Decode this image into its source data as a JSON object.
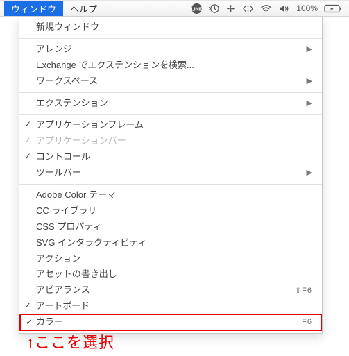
{
  "menubar": {
    "window": "ウィンドウ",
    "help": "ヘルプ",
    "battery": "100%"
  },
  "dropdown": {
    "new_window": "新規ウィンドウ",
    "arrange": "アレンジ",
    "find_ext": "Exchange でエクステンションを検索...",
    "workspace": "ワークスペース",
    "extension": "エクステンション",
    "app_frame": "アプリケーションフレーム",
    "app_bar": "アプリケーションバー",
    "control": "コントロール",
    "toolbar": "ツールバー",
    "adobe_color": "Adobe Color テーマ",
    "cc_library": "CC ライブラリ",
    "css_prop": "CSS プロパティ",
    "svg_inter": "SVG インタラクティビティ",
    "action": "アクション",
    "asset_export": "アセットの書き出し",
    "appearance": "アピアランス",
    "appearance_sc": "⇧F6",
    "artboard": "アートボード",
    "color": "カラー",
    "color_sc": "F6"
  },
  "annotation": "↑ここを選択"
}
